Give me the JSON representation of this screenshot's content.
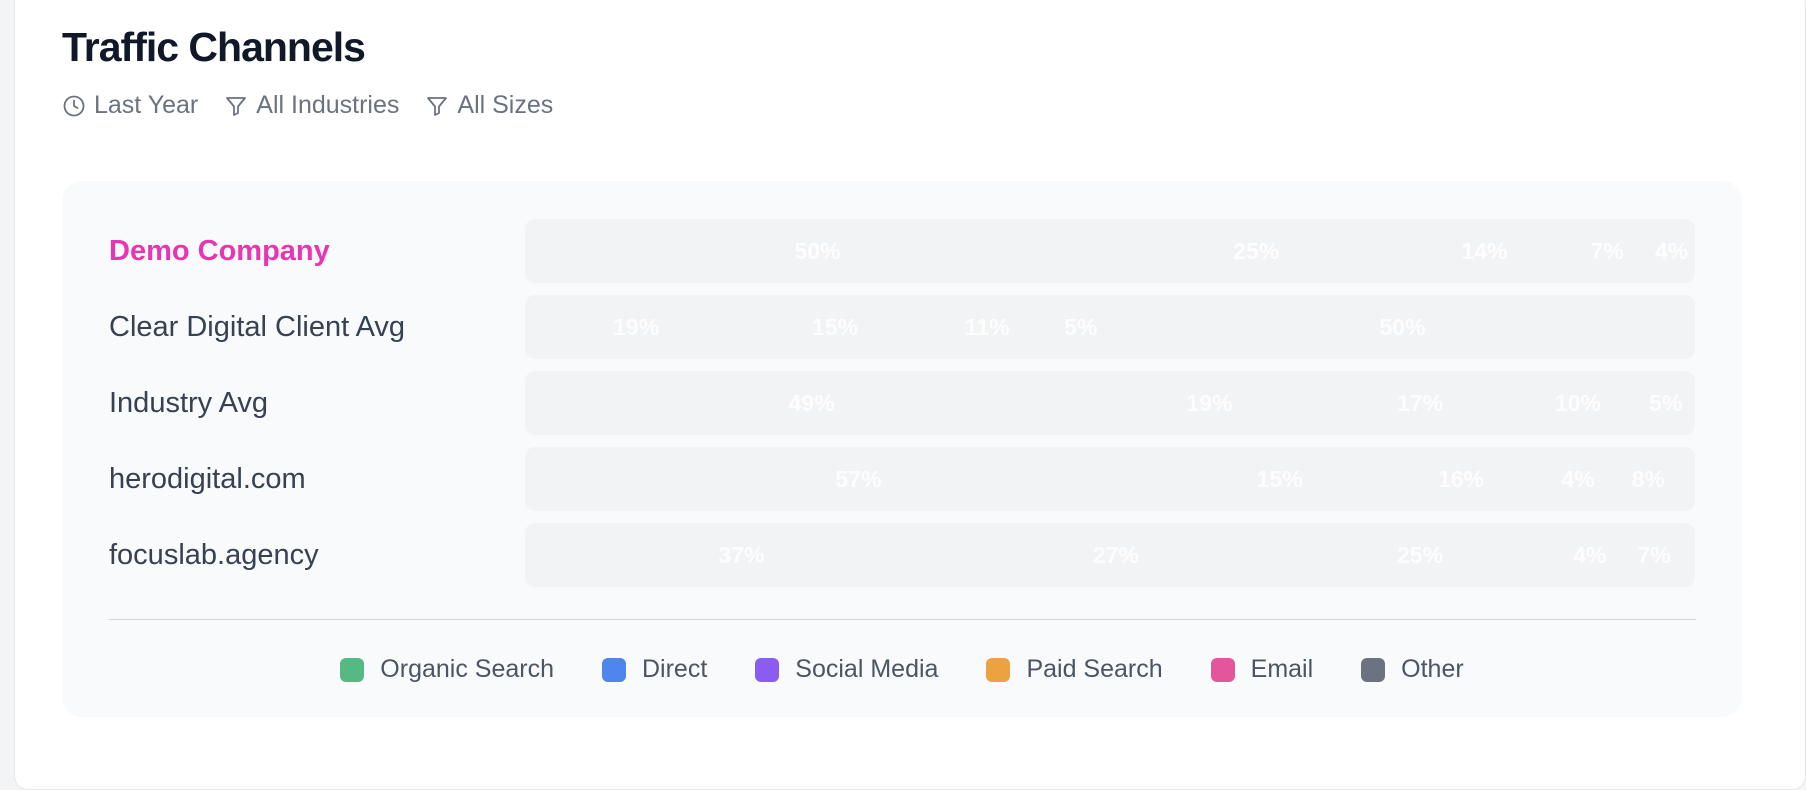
{
  "card": {
    "title": "Traffic Channels",
    "filters": [
      {
        "icon": "clock-icon",
        "label": "Last Year"
      },
      {
        "icon": "filter-icon",
        "label": "All Industries"
      },
      {
        "icon": "filter-icon",
        "label": "All Sizes"
      }
    ]
  },
  "colors": {
    "highlight": "#e735b4",
    "Organic Search": "#55b885",
    "Direct": "#4f86ee",
    "Social Media": "#8a5cf2",
    "Paid Search": "#eca23e",
    "Email": "#e3569c",
    "Other": "#6b7280"
  },
  "chart_data": {
    "type": "bar",
    "stacked": true,
    "orientation": "horizontal",
    "xlim": [
      0,
      100
    ],
    "unit": "%",
    "legend_position": "bottom",
    "categories": [
      "Demo Company",
      "Clear Digital Client Avg",
      "Industry Avg",
      "herodigital.com",
      "focuslab.agency"
    ],
    "highlight_category": "Demo Company",
    "series": [
      {
        "name": "Organic Search",
        "values": [
          50,
          19,
          49,
          57,
          37
        ]
      },
      {
        "name": "Direct",
        "values": [
          25,
          15,
          19,
          15,
          27
        ]
      },
      {
        "name": "Social Media",
        "values": [
          14,
          11,
          17,
          16,
          25
        ]
      },
      {
        "name": "Paid Search",
        "values": [
          7,
          5,
          10,
          4,
          4
        ]
      },
      {
        "name": "Email",
        "values": [
          4,
          50,
          5,
          8,
          7
        ]
      },
      {
        "name": "Other",
        "values": [
          0,
          0,
          0,
          0,
          0
        ]
      }
    ]
  }
}
